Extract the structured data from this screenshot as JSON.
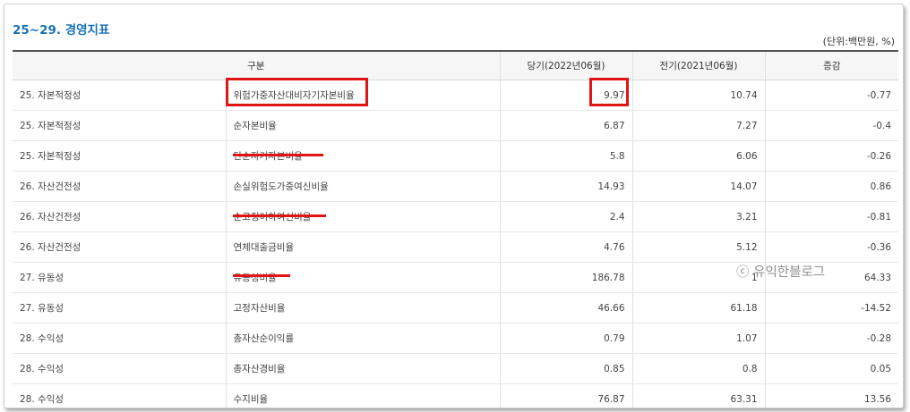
{
  "title": "25~29. 경영지표",
  "unit": "(단위:백만원, %)",
  "columns": [
    "구분",
    "",
    "당기(2022년06월)",
    "전기(2021년06월)",
    "증감"
  ],
  "rows": [
    {
      "category": "25. 자본적정성",
      "item": "위험가중자산대비자기자본비율",
      "current": "9.97",
      "previous": "10.74",
      "change": "-0.77"
    },
    {
      "category": "25. 자본적정성",
      "item": "순자본비율",
      "current": "6.87",
      "previous": "7.27",
      "change": "-0.4"
    },
    {
      "category": "25. 자본적정성",
      "item": "단순자기자본비율",
      "current": "5.8",
      "previous": "6.06",
      "change": "-0.26"
    },
    {
      "category": "26. 자산건전성",
      "item": "손실위험도가중여신비율",
      "current": "14.93",
      "previous": "14.07",
      "change": "0.86"
    },
    {
      "category": "26. 자산건전성",
      "item": "순고정이하여신비율",
      "current": "2.4",
      "previous": "3.21",
      "change": "-0.81"
    },
    {
      "category": "26. 자산건전성",
      "item": "연체대출금비율",
      "current": "4.76",
      "previous": "5.12",
      "change": "-0.36"
    },
    {
      "category": "27. 유동성",
      "item": "유동성비율",
      "current": "186.78",
      "previous": "1",
      "change": "64.33"
    },
    {
      "category": "27. 유동성",
      "item": "고정자산비율",
      "current": "46.66",
      "previous": "61.18",
      "change": "-14.52"
    },
    {
      "category": "28. 수익성",
      "item": "총자산순이익률",
      "current": "0.79",
      "previous": "1.07",
      "change": "-0.28"
    },
    {
      "category": "28. 수익성",
      "item": "총자산경비율",
      "current": "0.85",
      "previous": "0.8",
      "change": "0.05"
    },
    {
      "category": "28. 수익성",
      "item": "수지비율",
      "current": "76.87",
      "previous": "63.31",
      "change": "13.56"
    }
  ],
  "watermark": "ⓒ 유익한블로그",
  "colors": {
    "title": "#1a72b6",
    "highlight": "#e01414"
  }
}
